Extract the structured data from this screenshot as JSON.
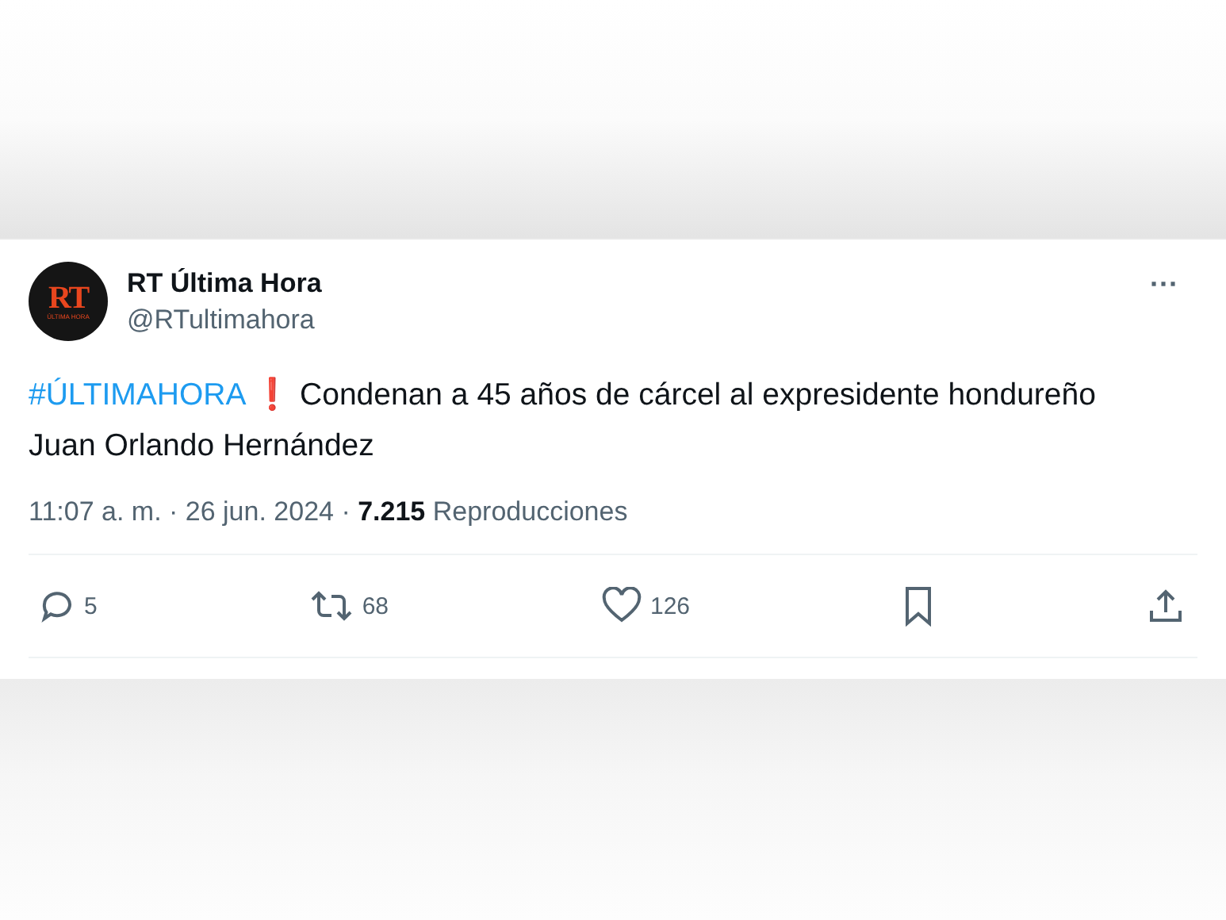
{
  "author": {
    "logo_text": "RT",
    "logo_subtext": "ÚLTIMA HORA",
    "name": "RT Última Hora",
    "handle": "@RTultimahora"
  },
  "more_button": "···",
  "tweet": {
    "hashtag": "#ÚLTIMAHORA",
    "emoji": "❗",
    "body": "Condenan a 45 años de cárcel al expresidente hondureño Juan Orlando Hernández"
  },
  "meta": "11:07 a. m. · 26 jun. 2024 · **7.215** Reproducciones",
  "actions": [
    {
      "kind": "reply",
      "count": "5"
    },
    {
      "kind": "repost",
      "count": "68"
    },
    {
      "kind": "like",
      "count": "126"
    },
    {
      "kind": "bookmark"
    },
    {
      "kind": "share"
    }
  ]
}
